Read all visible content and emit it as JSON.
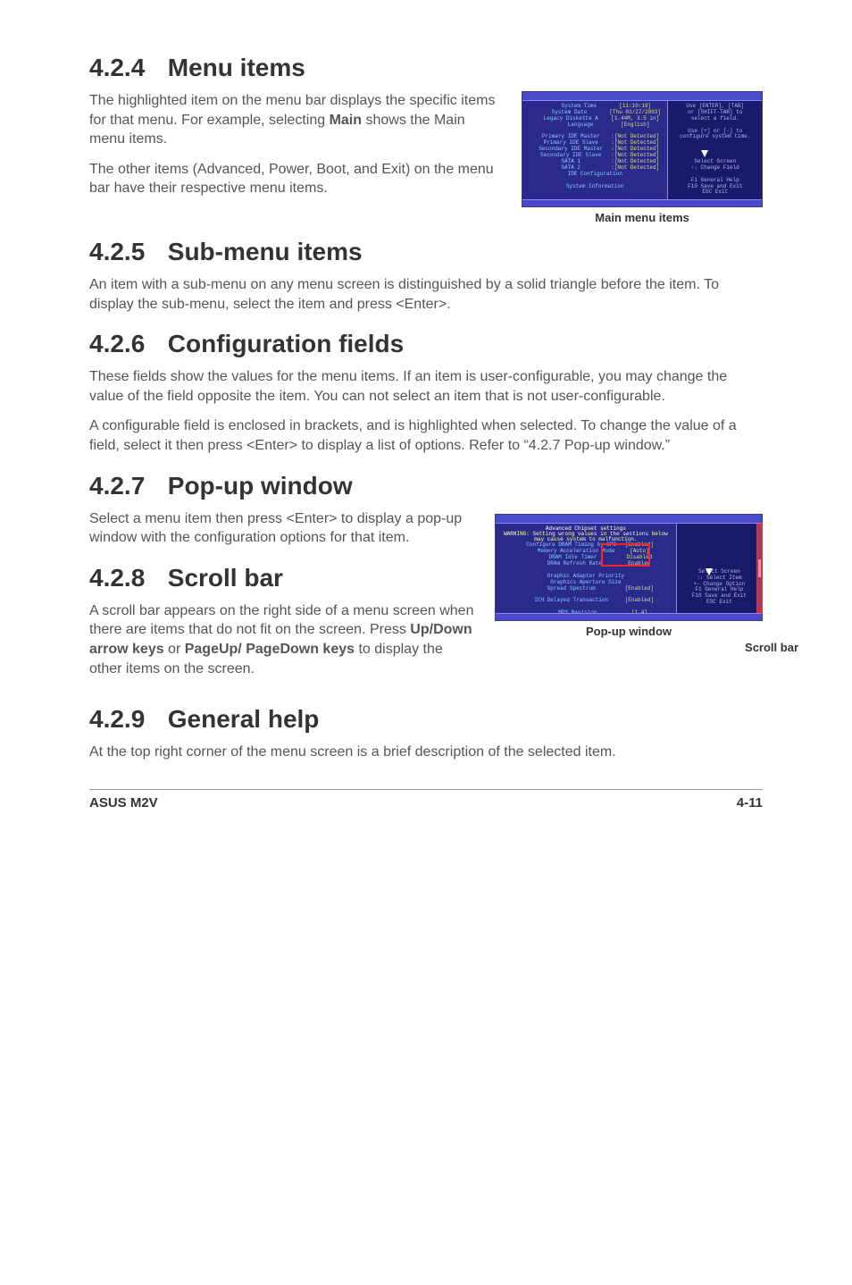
{
  "sections": {
    "s424": {
      "num": "4.2.4",
      "title": "Menu items",
      "p1": "The highlighted item on the menu bar displays the specific items for that menu. For example, selecting ",
      "p1bold": "Main",
      "p1b": " shows the Main menu items.",
      "p2": "The other items (Advanced, Power, Boot, and Exit) on the menu bar have their respective menu items."
    },
    "s425": {
      "num": "4.2.5",
      "title": "Sub-menu items",
      "p1": "An item with a sub-menu on any menu screen is distinguished by a solid triangle before the item. To display the sub-menu, select the item and press <Enter>."
    },
    "s426": {
      "num": "4.2.6",
      "title": "Configuration fields",
      "p1": "These fields show the values for the menu items. If an item is user-configurable, you may change the value of the field opposite the item. You can not select an item that is not user-configurable.",
      "p2": "A configurable field is enclosed in brackets, and is highlighted when selected. To change the value of a field, select it then press <Enter> to display a list of options. Refer to “4.2.7 Pop-up window.”"
    },
    "s427": {
      "num": "4.2.7",
      "title": "Pop-up window",
      "p1": "Select a menu item then press <Enter> to display a pop-up window with the configuration options for that item."
    },
    "s428": {
      "num": "4.2.8",
      "title": "Scroll bar",
      "p1a": "A scroll bar appears on the right side of a menu screen when there are items that do not fit on the screen. Press ",
      "p1bold1": "Up/Down arrow keys",
      "p1mid": " or ",
      "p1bold2": "PageUp/ PageDown keys",
      "p1b": " to display the other items on the screen."
    },
    "s429": {
      "num": "4.2.9",
      "title": "General help",
      "p1": "At the top right corner of the menu screen is a brief description of the selected item."
    }
  },
  "captions": {
    "main_menu": "Main menu items",
    "popup": "Pop-up window",
    "scrollbar": "Scroll bar"
  },
  "footer": {
    "left": "ASUS M2V",
    "right": "4-11"
  },
  "bios1": {
    "rows": [
      {
        "l": "System Time",
        "v": "[11:10:19]"
      },
      {
        "l": "System Date",
        "v": "[Thu 03/27/2003]"
      },
      {
        "l": "Legacy Diskette A",
        "v": "[1.44M, 3.5 in]"
      },
      {
        "l": "Language",
        "v": "[English]"
      },
      {
        "l": "",
        "v": ""
      },
      {
        "l": "Primary IDE Master",
        "v": ":[Not Detected]"
      },
      {
        "l": "Primary IDE Slave",
        "v": ":[Not Detected]"
      },
      {
        "l": "Secondary IDE Master",
        "v": ":[Not Detected]"
      },
      {
        "l": "Secondary IDE Slave",
        "v": ":[Not Detected]"
      },
      {
        "l": "SATA 1",
        "v": ":[Not Detected]"
      },
      {
        "l": "SATA 2",
        "v": ":[Not Detected]"
      },
      {
        "l": "IDE Configuration",
        "v": ""
      },
      {
        "l": "",
        "v": ""
      },
      {
        "l": "System Information",
        "v": ""
      }
    ],
    "help": [
      "Use [ENTER], [TAB]",
      "or [SHIFT-TAB] to",
      "select a field.",
      "",
      "Use [+] or [-] to",
      "configure system time.",
      "",
      "",
      "",
      "    Select Screen",
      "↑↓  Change Field",
      "",
      "F1   General Help",
      "F10  Save and Exit",
      "ESC  Exit"
    ]
  },
  "bios2": {
    "title": "Advanced Chipset settings",
    "warn": "WARNING: Setting wrong values in the sections below may cause system to malfunction.",
    "rows": [
      {
        "l": "Configure DRAM Timing by SPD",
        "v": "[Enabled]"
      },
      {
        "l": "Memory Acceleration Mode",
        "v": "[Auto]"
      },
      {
        "l": "DRAM Idle Timer",
        "v": "Disabled"
      },
      {
        "l": "DRAm Refresh Rate",
        "v": "Enabled"
      },
      {
        "l": "",
        "v": ""
      },
      {
        "l": "Graphic Adapter Priority",
        "v": ""
      },
      {
        "l": "Graphics Aperture Size",
        "v": ""
      },
      {
        "l": "Spread Spectrum",
        "v": "[Enabled]"
      },
      {
        "l": "",
        "v": ""
      },
      {
        "l": "ICH Delayed Transaction",
        "v": "[Enabled]"
      },
      {
        "l": "",
        "v": ""
      },
      {
        "l": "MPS Revision",
        "v": "[1.4]"
      }
    ],
    "help": [
      "",
      "",
      "",
      "",
      "",
      "",
      "",
      "    Select Screen",
      "↑↓  Select Item",
      "+-   Change Option",
      "F1   General Help",
      "F10  Save and Exit",
      "ESC  Exit"
    ]
  }
}
